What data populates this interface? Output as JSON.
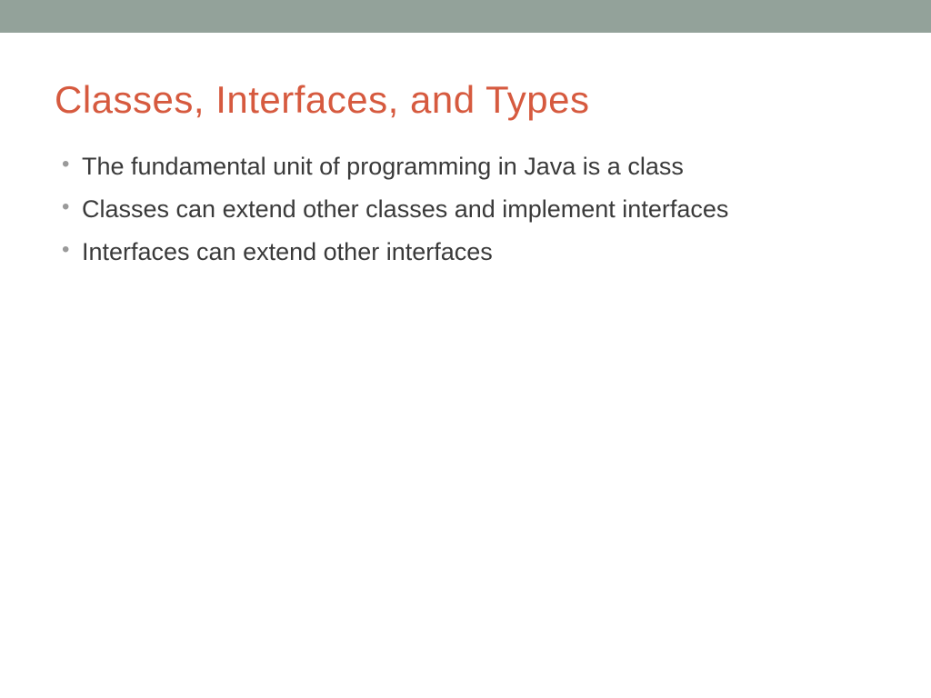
{
  "slide": {
    "title": "Classes, Interfaces, and Types",
    "bullets": [
      "The fundamental unit of programming in Java is a class",
      "Classes can extend other classes and implement interfaces",
      "Interfaces can extend other interfaces"
    ]
  },
  "colors": {
    "topbar": "#93a29a",
    "title": "#d65a3f",
    "body": "#3a3a3a",
    "bullet_marker": "#9a9a9a"
  }
}
